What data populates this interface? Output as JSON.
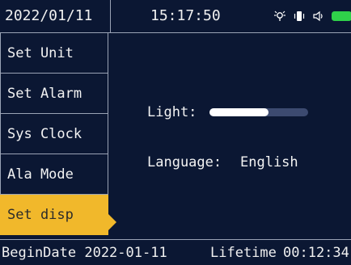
{
  "header": {
    "date": "2022/01/11",
    "time": "15:17:50",
    "icons": [
      "backlight-icon",
      "vibrate-icon",
      "speaker-icon",
      "battery-icon"
    ],
    "battery_color": "#2fd14a"
  },
  "sidebar": {
    "items": [
      {
        "label": "Set Unit"
      },
      {
        "label": "Set Alarm"
      },
      {
        "label": "Sys Clock"
      },
      {
        "label": "Ala Mode"
      },
      {
        "label": "Set disp"
      }
    ],
    "active_index": 4,
    "active_color": "#f1b82b"
  },
  "main": {
    "light_label": "Light:",
    "light_level": 0.6,
    "language_label": "Language:",
    "language_value": "English"
  },
  "footer": {
    "begin_label": "BeginDate 2022-01-11",
    "lifetime_label": "Lifetime",
    "elapsed": "00:12:34"
  }
}
